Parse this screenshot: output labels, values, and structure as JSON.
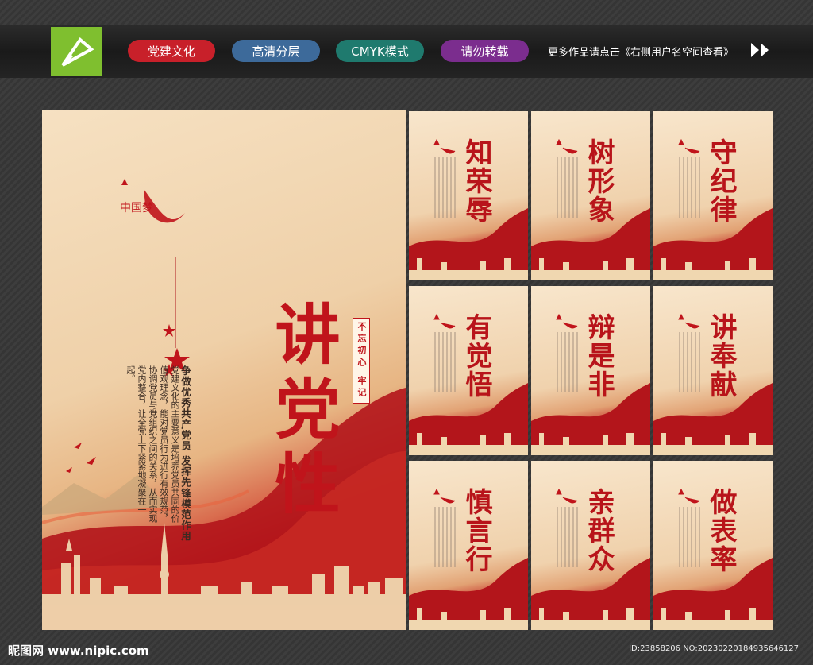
{
  "header": {
    "tags": [
      {
        "label": "党建文化",
        "color": "#c8202a"
      },
      {
        "label": "高清分层",
        "color": "#3d6a9a"
      },
      {
        "label": "CMYK模式",
        "color": "#1f7a6e"
      },
      {
        "label": "请勿转载",
        "color": "#7b2d8e"
      }
    ],
    "more_text": "更多作品请点击《右侧用户名空间查看》"
  },
  "main_poster": {
    "title": "讲党性",
    "slogan": "争做优秀共产党员 发挥先锋模范作用",
    "body": "党建文化的主要意义是培养党员共同的价值观理念，能对党员行为进行有效规范，协调党员与党组织之间的关系，从而实现党内整合，让全党上下紧紧地凝聚在一起。",
    "seal": "不忘初心 牢记",
    "logo_text": "中国梦"
  },
  "small_posters": [
    {
      "title": "知荣辱"
    },
    {
      "title": "树形象"
    },
    {
      "title": "守纪律"
    },
    {
      "title": "有觉悟"
    },
    {
      "title": "辩是非"
    },
    {
      "title": "讲奉献"
    },
    {
      "title": "慎言行"
    },
    {
      "title": "亲群众"
    },
    {
      "title": "做表率"
    }
  ],
  "footer": {
    "site": "昵图网 www.nipic.com",
    "id": "ID:23858206 NO:20230220184935646127"
  },
  "colors": {
    "accent_red": "#c0141b",
    "logo_green": "#7fbf2f"
  }
}
